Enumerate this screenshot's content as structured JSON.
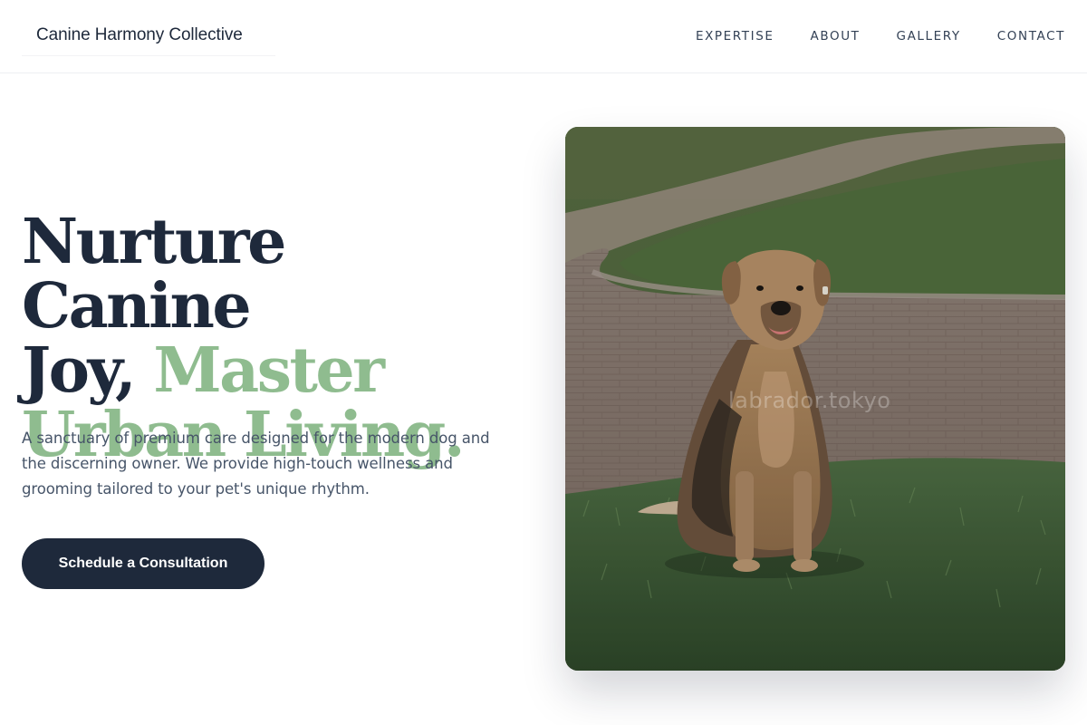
{
  "header": {
    "brand": "Canine Harmony Collective",
    "nav": [
      "EXPERTISE",
      "ABOUT",
      "GALLERY",
      "CONTACT"
    ]
  },
  "hero": {
    "headline_line1": "Nurture Canine",
    "headline_line2_start": "Joy, ",
    "headline_accent_1": "Master",
    "headline_accent_2": "Urban Living.",
    "description": "A sanctuary of premium care designed for the modern dog and the discerning owner. We provide high-touch wellness and grooming tailored to your pet's unique rhythm.",
    "cta_label": "Schedule a Consultation",
    "image_watermark": "labrador.tokyo"
  },
  "colors": {
    "primary": "#1e293b",
    "accent": "#8fbc8f",
    "text_muted": "#475569"
  }
}
